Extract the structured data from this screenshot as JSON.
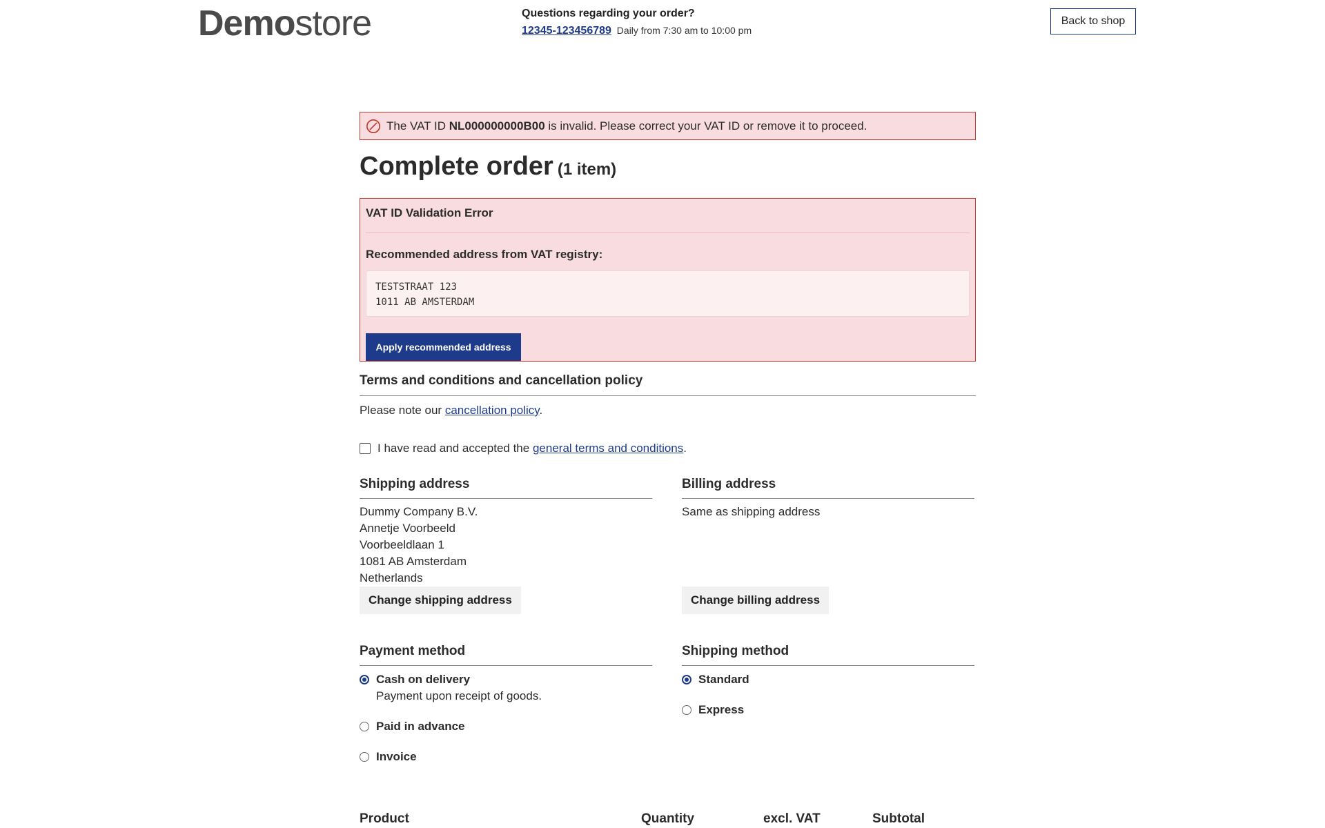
{
  "header": {
    "logo_bold": "Demo",
    "logo_light": "store",
    "help_question": "Questions regarding your order?",
    "help_phone": "12345-123456789",
    "help_hours": "Daily from 7:30 am to 10:00 pm",
    "back_label": "Back to shop"
  },
  "alert": {
    "prefix": "The VAT ID",
    "vat_id": "NL000000000B00",
    "suffix": "is invalid. Please correct your VAT ID or remove it to proceed.",
    "icon": "forbidden-icon"
  },
  "page": {
    "title": "Complete order",
    "count": "(1 item)"
  },
  "vat_box": {
    "title": "VAT ID Validation Error",
    "recommended_label": "Recommended address from VAT registry:",
    "address_line1": "TESTSTRAAT 123",
    "address_line2": "1011 AB AMSTERDAM",
    "apply_label": "Apply recommended address"
  },
  "terms": {
    "title": "Terms and conditions and cancellation policy",
    "note_prefix": "Please note our",
    "note_link": "cancellation policy",
    "note_suffix": ".",
    "check_prefix": "I have read and accepted the",
    "check_link": "general terms and conditions",
    "check_suffix": ".",
    "checked": false
  },
  "shipping_address": {
    "title": "Shipping address",
    "lines": [
      "Dummy Company B.V.",
      "Annetje Voorbeeld",
      "Voorbeeldlaan 1",
      "1081 AB Amsterdam",
      "Netherlands"
    ],
    "change_label": "Change shipping address"
  },
  "billing_address": {
    "title": "Billing address",
    "text": "Same as shipping address",
    "change_label": "Change billing address"
  },
  "payment": {
    "title": "Payment method",
    "options": [
      {
        "label": "Cash on delivery",
        "desc": "Payment upon receipt of goods.",
        "selected": true
      },
      {
        "label": "Paid in advance",
        "selected": false
      },
      {
        "label": "Invoice",
        "selected": false
      }
    ]
  },
  "shipping_method": {
    "title": "Shipping method",
    "options": [
      {
        "label": "Standard",
        "selected": true
      },
      {
        "label": "Express",
        "selected": false
      }
    ]
  },
  "table": {
    "columns": [
      "Product",
      "Quantity",
      "excl. VAT",
      "Subtotal"
    ]
  },
  "colors": {
    "accent": "#1e3a8a",
    "error_bg": "#f9dcdf",
    "error_border": "#c0392b"
  }
}
